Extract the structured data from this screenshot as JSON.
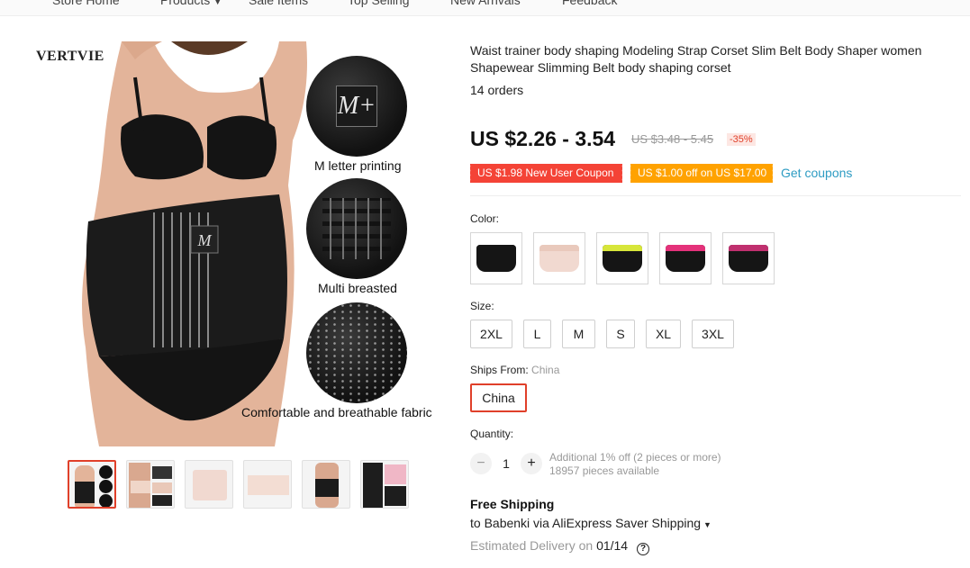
{
  "nav": {
    "items": [
      "Store Home",
      "Products",
      "Sale Items",
      "Top Selling",
      "New Arrivals",
      "Feedback"
    ]
  },
  "gallery": {
    "brand": "VERTVIE",
    "logo_text": "M+",
    "captions": [
      "M letter printing",
      "Multi breasted",
      "Comfortable and breathable fabric"
    ],
    "selected_thumbnail_index": 0
  },
  "product": {
    "title": "Waist trainer body shaping Modeling Strap Corset Slim Belt Body Shaper women Shapewear Slimming Belt body shaping corset",
    "orders": "14 orders",
    "price": "US $2.26 - 3.54",
    "original_price": "US $3.48 - 5.45",
    "discount": "-35%"
  },
  "coupons": {
    "new_user": "US $1.98 New User Coupon",
    "store": "US $1.00 off on US $17.00",
    "get_coupons": "Get coupons",
    "colors": {
      "red": "#f44336",
      "orange": "#ffa200",
      "link": "#2e9cc3"
    }
  },
  "color_option": {
    "label": "Color:",
    "swatches": [
      {
        "name": "black",
        "band_color": "#151515"
      },
      {
        "name": "nude",
        "band_color": "#f1d9d0"
      },
      {
        "name": "black-yellow",
        "band_color": "#d7e63a"
      },
      {
        "name": "black-rose",
        "band_color": "#e4327a"
      },
      {
        "name": "black-pink",
        "band_color": "#c0306f"
      }
    ]
  },
  "size_option": {
    "label": "Size:",
    "sizes": [
      "2XL",
      "L",
      "M",
      "S",
      "XL",
      "3XL"
    ]
  },
  "ships_from": {
    "label": "Ships From:",
    "value": "China",
    "option": "China"
  },
  "quantity": {
    "label": "Quantity:",
    "value": "1",
    "minus": "−",
    "plus": "+",
    "note": "Additional 1% off (2 pieces or more)",
    "available": "18957 pieces available"
  },
  "shipping": {
    "title": "Free Shipping",
    "method": "to Babenki via AliExpress Saver Shipping",
    "delivery_label": "Estimated Delivery on",
    "delivery_date": "01/14"
  },
  "accent_color": "#e0402a"
}
